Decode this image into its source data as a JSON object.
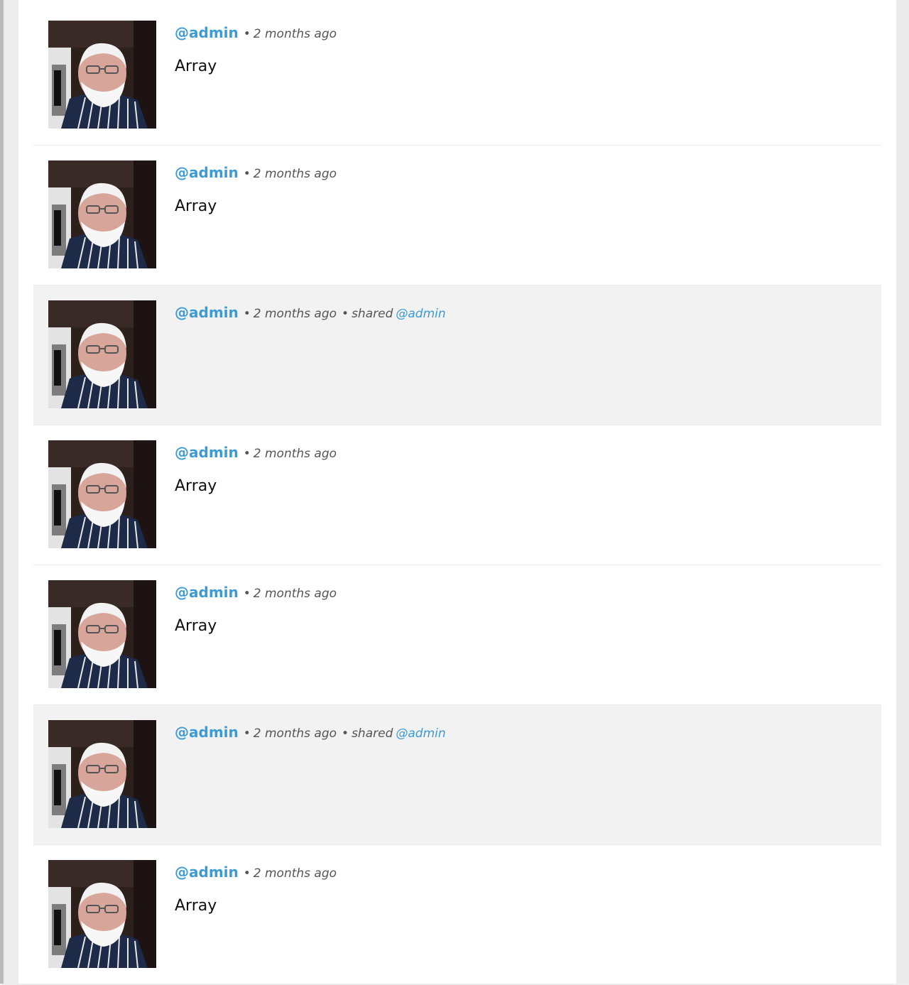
{
  "feed": {
    "separator": "•",
    "posts": [
      {
        "username": "@admin",
        "time": "2 months ago",
        "content": "Array"
      },
      {
        "username": "@admin",
        "time": "2 months ago",
        "content": "Array"
      },
      {
        "username": "@admin",
        "time": "2 months ago",
        "shared_label": "shared",
        "shared_user": "@admin",
        "content": ""
      },
      {
        "username": "@admin",
        "time": "2 months ago",
        "content": "Array"
      },
      {
        "username": "@admin",
        "time": "2 months ago",
        "content": "Array"
      },
      {
        "username": "@admin",
        "time": "2 months ago",
        "shared_label": "shared",
        "shared_user": "@admin",
        "content": ""
      },
      {
        "username": "@admin",
        "time": "2 months ago",
        "content": "Array"
      }
    ]
  },
  "avatar": {
    "description": "profile photo",
    "icon": "user-avatar-photo"
  },
  "colors": {
    "link": "#3d9bd3",
    "shared_bg": "#f2f2f2",
    "meta_text": "#555555"
  }
}
